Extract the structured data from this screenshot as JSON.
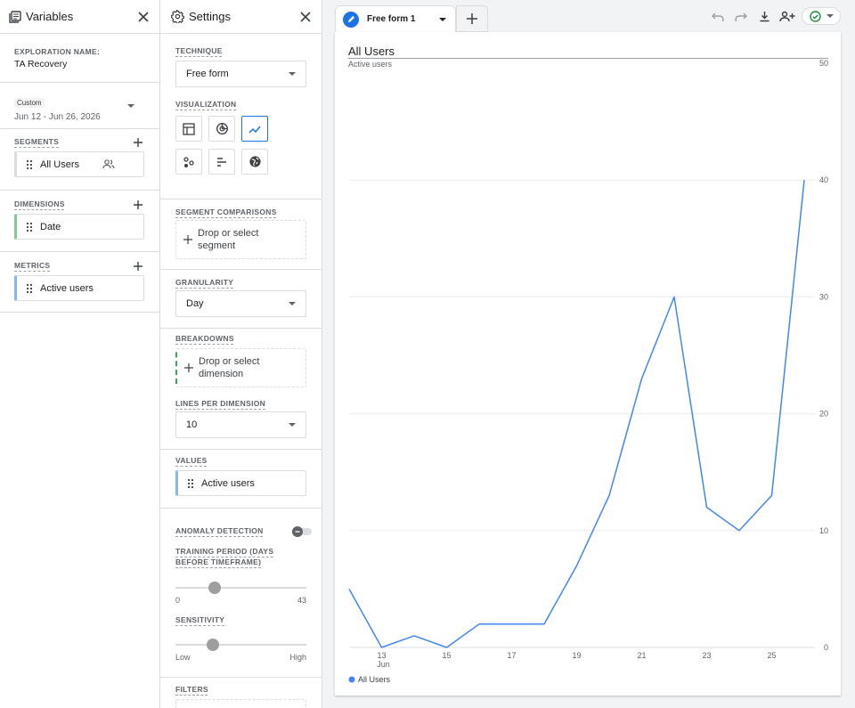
{
  "variables": {
    "title": "Variables",
    "exploration_name_label": "EXPLORATION NAME:",
    "exploration_name": "TA Recovery",
    "date_badge": "Custom",
    "date_range": "Jun 12 - Jun 26, 2026",
    "segments_label": "SEGMENTS",
    "segment_item": "All Users",
    "dimensions_label": "DIMENSIONS",
    "dimension_item": "Date",
    "metrics_label": "METRICS",
    "metric_item": "Active users"
  },
  "settings": {
    "title": "Settings",
    "technique_label": "TECHNIQUE",
    "technique_value": "Free form",
    "visualization_label": "VISUALIZATION",
    "segment_comparisons_label": "SEGMENT COMPARISONS",
    "segment_drop_text": "Drop or select segment",
    "granularity_label": "GRANULARITY",
    "granularity_value": "Day",
    "breakdowns_label": "BREAKDOWNS",
    "breakdown_drop_text": "Drop or select dimension",
    "lines_per_dimension_label": "LINES PER DIMENSION",
    "lines_per_dimension_value": "10",
    "values_label": "VALUES",
    "values_item": "Active users",
    "anomaly_label": "ANOMALY DETECTION",
    "anomaly_enabled": false,
    "training_label": "TRAINING PERIOD (DAYS BEFORE TIMEFRAME)",
    "training_min": "0",
    "training_max": "43",
    "training_value_fraction": 0.28,
    "sensitivity_label": "SENSITIVITY",
    "sensitivity_min": "Low",
    "sensitivity_max": "High",
    "sensitivity_value_fraction": 0.26,
    "filters_label": "FILTERS"
  },
  "tabs": {
    "active_tab": "Free form 1"
  },
  "colors": {
    "accent": "#1a73e8",
    "series": "#4285f4",
    "status_ok": "#1e8e3e"
  },
  "chart_data": {
    "type": "line",
    "title": "All Users",
    "ylabel": "Active users",
    "x_tick_labels": [
      "13",
      "15",
      "17",
      "19",
      "21",
      "23",
      "25"
    ],
    "x_tick_sublabel": "Jun",
    "y_ticks": [
      0,
      10,
      20,
      30,
      40,
      50
    ],
    "ylim": [
      0,
      50
    ],
    "x": [
      12,
      13,
      14,
      15,
      16,
      17,
      18,
      19,
      20,
      21,
      22,
      23,
      24,
      25,
      26
    ],
    "series": [
      {
        "name": "All Users",
        "values": [
          5,
          0,
          1,
          0,
          2,
          2,
          2,
          7,
          13,
          23,
          30,
          12,
          10,
          13,
          40
        ]
      }
    ],
    "legend_position": "bottom-left",
    "grid": true
  }
}
